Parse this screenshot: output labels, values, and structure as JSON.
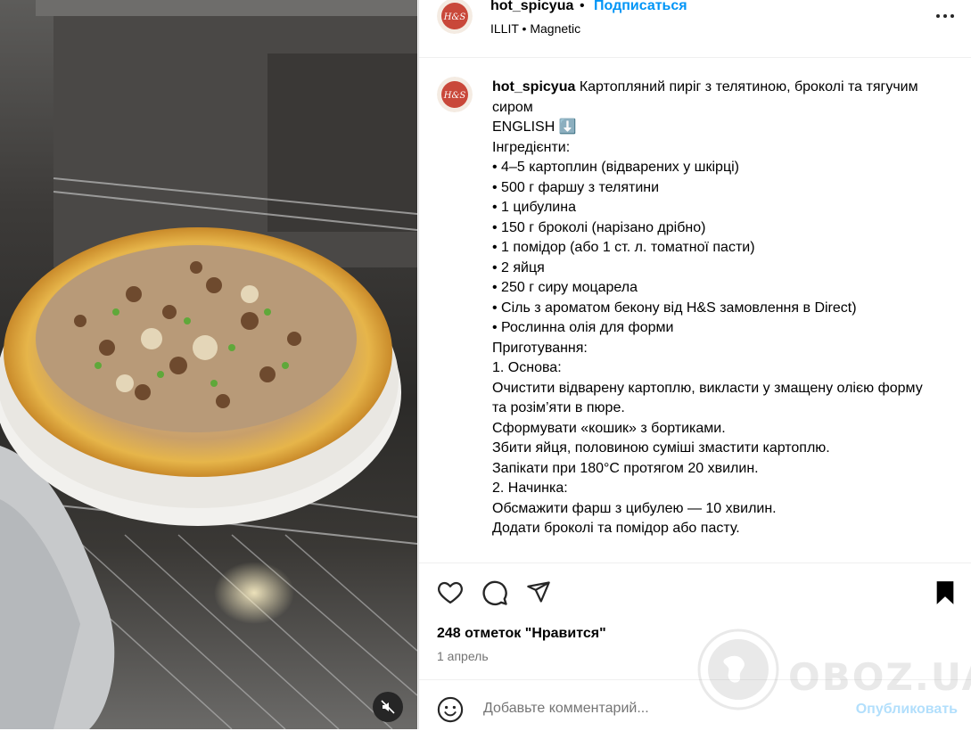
{
  "post": {
    "username": "hot_spicyua",
    "separator": "•",
    "follow_label": "Подписаться",
    "audio": "ILLIT • Magnetic",
    "avatar_text": "H&S"
  },
  "caption": {
    "username": "hot_spicyua",
    "lines": [
      "Картопляний пиріг з телятиною, броколі та тягучим сиром",
      "",
      "ENGLISH ⬇️",
      "",
      "Інгредієнти:",
      "• 4–5 картоплин (відварених у шкірці)",
      "• 500 г фаршу з телятини",
      "• 1 цибулина",
      "• 150 г броколі (нарізано дрібно)",
      "• 1 помідор (або 1 ст. л. томатної пасти)",
      "• 2 яйця",
      "• 250 г сиру моцарела",
      "• Сіль з ароматом бекону від H&S замовлення в Direct)",
      "• Рослинна олія для форми",
      "Приготування:",
      "1. Основа:",
      "Очистити відварену картоплю, викласти у змащену олією форму та розім’яти в пюре.",
      "Сформувати «кошик» з бортиками.",
      "Збити яйця, половиною суміші змастити картоплю.",
      "Запікати при 180°C протягом 20 хвилин.",
      "2. Начинка:",
      "Обсмажити фарш з цибулею — 10 хвилин.",
      "Додати броколі та помідор або пасту."
    ]
  },
  "actions": {
    "likes": "248 отметок \"Нравится\"",
    "date": "1 апрель",
    "comment_placeholder": "Добавьте комментарий...",
    "publish_label": "Опубликовать"
  },
  "watermark": {
    "text": "OBOZ.UA"
  },
  "colors": {
    "link": "#0095f6",
    "publish_disabled": "#b2dffc",
    "muted_text": "#737373"
  },
  "icons": [
    "more-options-icon",
    "like-heart-icon",
    "comment-icon",
    "share-icon",
    "save-bookmark-icon",
    "emoji-icon",
    "mute-icon"
  ]
}
